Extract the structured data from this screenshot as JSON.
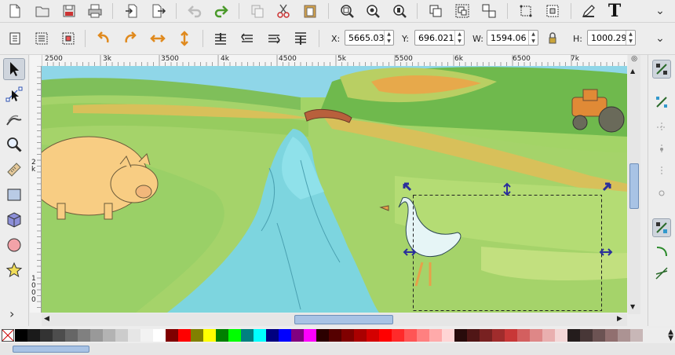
{
  "commands": [
    {
      "name": "new-document-icon"
    },
    {
      "name": "open-icon"
    },
    {
      "name": "save-icon"
    },
    {
      "name": "print-icon"
    },
    {
      "name": "import-icon"
    },
    {
      "name": "export-icon"
    },
    {
      "name": "undo-icon"
    },
    {
      "name": "redo-icon"
    },
    {
      "name": "copy-icon"
    },
    {
      "name": "cut-icon"
    },
    {
      "name": "paste-icon"
    },
    {
      "name": "zoom-selection-icon"
    },
    {
      "name": "zoom-drawing-icon"
    },
    {
      "name": "zoom-page-icon"
    },
    {
      "name": "duplicate-icon"
    },
    {
      "name": "group-icon"
    },
    {
      "name": "ungroup-icon"
    },
    {
      "name": "fill-stroke-icon"
    },
    {
      "name": "xml-editor-icon"
    },
    {
      "name": "edit-icon"
    },
    {
      "name": "text-icon"
    }
  ],
  "text_tool_glyph": "T",
  "overflow_chevron": "⌄",
  "controls": {
    "x_label": "X:",
    "x_value": "5665.03",
    "y_label": "Y:",
    "y_value": "696.021",
    "w_label": "W:",
    "w_value": "1594.06",
    "h_label": "H:",
    "h_value": "1000.29",
    "lock_icon": "lock-icon"
  },
  "ruler": {
    "h_labels": [
      "2500",
      "3k",
      "3500",
      "4k",
      "4500",
      "5k",
      "5500",
      "6k",
      "6500",
      "7k"
    ],
    "v_labels_top": [
      "2",
      "k"
    ],
    "v_labels_bottom": [
      "1",
      "0",
      "0",
      "0"
    ]
  },
  "tools": [
    {
      "name": "selector-tool",
      "active": true
    },
    {
      "name": "node-tool"
    },
    {
      "name": "tweak-tool"
    },
    {
      "name": "zoom-tool"
    },
    {
      "name": "measure-tool"
    },
    {
      "name": "rectangle-tool"
    },
    {
      "name": "box3d-tool"
    },
    {
      "name": "ellipse-tool"
    },
    {
      "name": "star-tool"
    }
  ],
  "expand_arrow": "›",
  "palette": {
    "colors": [
      "#000000",
      "#1a1a1a",
      "#333333",
      "#4d4d4d",
      "#666666",
      "#808080",
      "#999999",
      "#b3b3b3",
      "#cccccc",
      "#e6e6e6",
      "#f2f2f2",
      "#ffffff",
      "#800000",
      "#ff0000",
      "#808000",
      "#ffff00",
      "#008000",
      "#00ff00",
      "#008080",
      "#00ffff",
      "#000080",
      "#0000ff",
      "#800080",
      "#ff00ff",
      "#2b0000",
      "#550000",
      "#800000",
      "#aa0000",
      "#d40000",
      "#ff0000",
      "#ff2a2a",
      "#ff5555",
      "#ff8080",
      "#ffaaaa",
      "#ffd5d5",
      "#280b0b",
      "#501616",
      "#782121",
      "#a02c2c",
      "#c83737",
      "#d35f5f",
      "#de8787",
      "#e9afaf",
      "#f4d7d7",
      "#241c1c",
      "#483737",
      "#6c5353",
      "#916f6f",
      "#ac9393",
      "#c8b7b7"
    ]
  }
}
